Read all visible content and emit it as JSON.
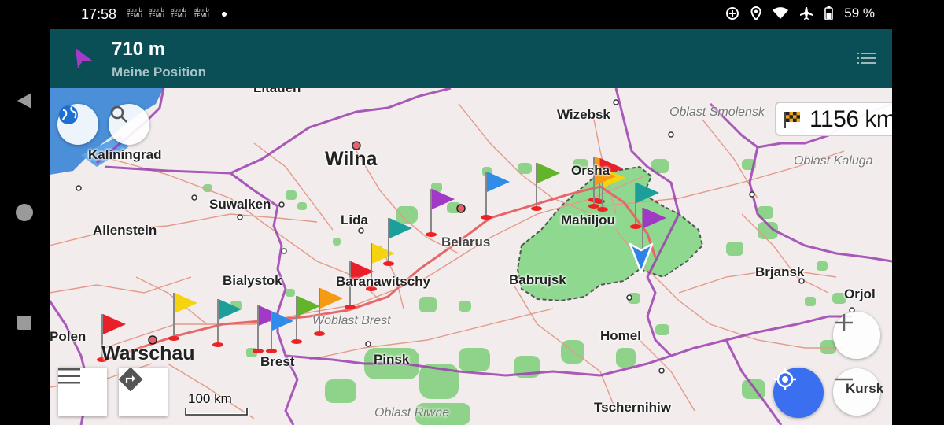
{
  "status_bar": {
    "time": "17:58",
    "notifications": [
      "TEMU",
      "TEMU",
      "TEMU",
      "TEMU"
    ],
    "battery": "59 %"
  },
  "header": {
    "distance": "710 m",
    "subtitle": "Meine Position"
  },
  "destination_widget": {
    "distance": "1156 km"
  },
  "scale": {
    "label": "100 km"
  },
  "map": {
    "cities": [
      "Wizebsk",
      "Kaliningrad",
      "Wilna",
      "Suwalken",
      "Lida",
      "Allenstein",
      "Belarus",
      "Mahiljou",
      "Bialystok",
      "Baranawitschy",
      "Babrujsk",
      "Brjansk",
      "Orjol",
      "Polen",
      "Warschau",
      "Brest",
      "Pinsk",
      "Homel",
      "Tschernihiw",
      "Kursk",
      "Litauen",
      "Orsha"
    ],
    "regions": [
      "Oblast Smolensk",
      "Oblast Kaluga",
      "Woblast Brest",
      "Oblast Riwne"
    ]
  },
  "colors": {
    "header_bg": "#0b4f56",
    "map_bg": "#f2ecec",
    "forest": "#8fd38a",
    "border": "#9c3fae",
    "location_button": "#3a6ff0"
  }
}
